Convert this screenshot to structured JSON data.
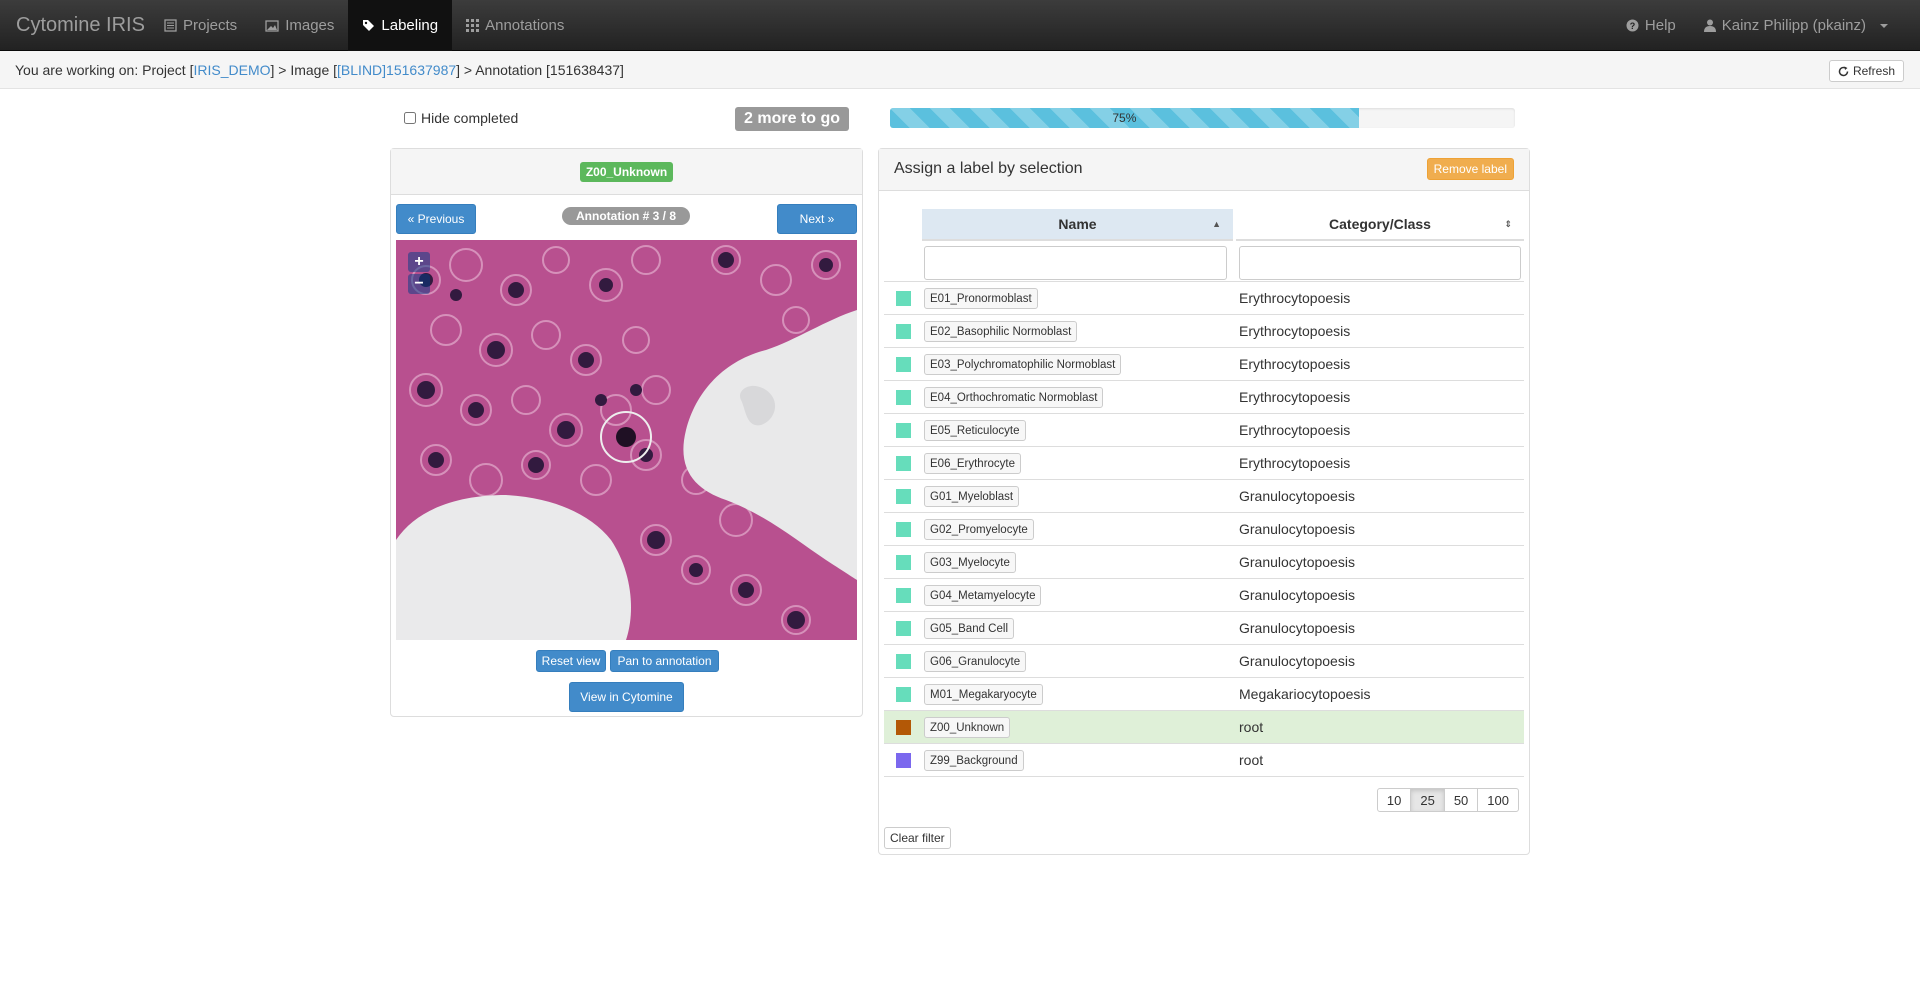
{
  "navbar": {
    "brand": "Cytomine IRIS",
    "items": [
      {
        "label": "Projects",
        "icon": "list-icon"
      },
      {
        "label": "Images",
        "icon": "picture-icon"
      },
      {
        "label": "Labeling",
        "icon": "tag-icon",
        "active": true
      },
      {
        "label": "Annotations",
        "icon": "grid-icon"
      }
    ],
    "help": "Help",
    "user": "Kainz Philipp (pkainz)"
  },
  "breadcrumb": {
    "prefix": "You are working on: Project [",
    "project": "IRIS_DEMO",
    "mid1": "] > Image [",
    "image": "[BLIND]151637987",
    "mid2": "] > Annotation [151638437]",
    "refresh": "Refresh"
  },
  "controls": {
    "hide_completed": "Hide completed",
    "remaining": "2 more to go",
    "progress_label": "75%",
    "progress_value": 75
  },
  "left": {
    "current_label": "Z00_Unknown",
    "previous": "« Previous",
    "next": "Next »",
    "annotation_counter": "Annotation # 3 / 8",
    "zoom_in": "+",
    "zoom_out": "−",
    "reset_view": "Reset view",
    "pan": "Pan to annotation",
    "view_in_cytomine": "View in Cytomine"
  },
  "right": {
    "title": "Assign a label by selection",
    "remove_label": "Remove label",
    "col_name": "Name",
    "col_category": "Category/Class",
    "rows": [
      {
        "name": "E01_Pronormoblast",
        "category": "Erythrocytopoesis",
        "color": "#66ddbb"
      },
      {
        "name": "E02_Basophilic Normoblast",
        "category": "Erythrocytopoesis",
        "color": "#66ddbb"
      },
      {
        "name": "E03_Polychromatophilic Normoblast",
        "category": "Erythrocytopoesis",
        "color": "#66ddbb"
      },
      {
        "name": "E04_Orthochromatic Normoblast",
        "category": "Erythrocytopoesis",
        "color": "#66ddbb"
      },
      {
        "name": "E05_Reticulocyte",
        "category": "Erythrocytopoesis",
        "color": "#66ddbb"
      },
      {
        "name": "E06_Erythrocyte",
        "category": "Erythrocytopoesis",
        "color": "#66ddbb"
      },
      {
        "name": "G01_Myeloblast",
        "category": "Granulocytopoesis",
        "color": "#66ddbb"
      },
      {
        "name": "G02_Promyelocyte",
        "category": "Granulocytopoesis",
        "color": "#66ddbb"
      },
      {
        "name": "G03_Myelocyte",
        "category": "Granulocytopoesis",
        "color": "#66ddbb"
      },
      {
        "name": "G04_Metamyelocyte",
        "category": "Granulocytopoesis",
        "color": "#66ddbb"
      },
      {
        "name": "G05_Band Cell",
        "category": "Granulocytopoesis",
        "color": "#66ddbb"
      },
      {
        "name": "G06_Granulocyte",
        "category": "Granulocytopoesis",
        "color": "#66ddbb"
      },
      {
        "name": "M01_Megakaryocyte",
        "category": "Megakariocytopoesis",
        "color": "#66ddbb"
      },
      {
        "name": "Z00_Unknown",
        "category": "root",
        "color": "#b35806",
        "selected": true
      },
      {
        "name": "Z99_Background",
        "category": "root",
        "color": "#7b68ee"
      }
    ],
    "page_sizes": [
      "10",
      "25",
      "50",
      "100"
    ],
    "active_page_size": "25",
    "clear_filter": "Clear filter"
  }
}
